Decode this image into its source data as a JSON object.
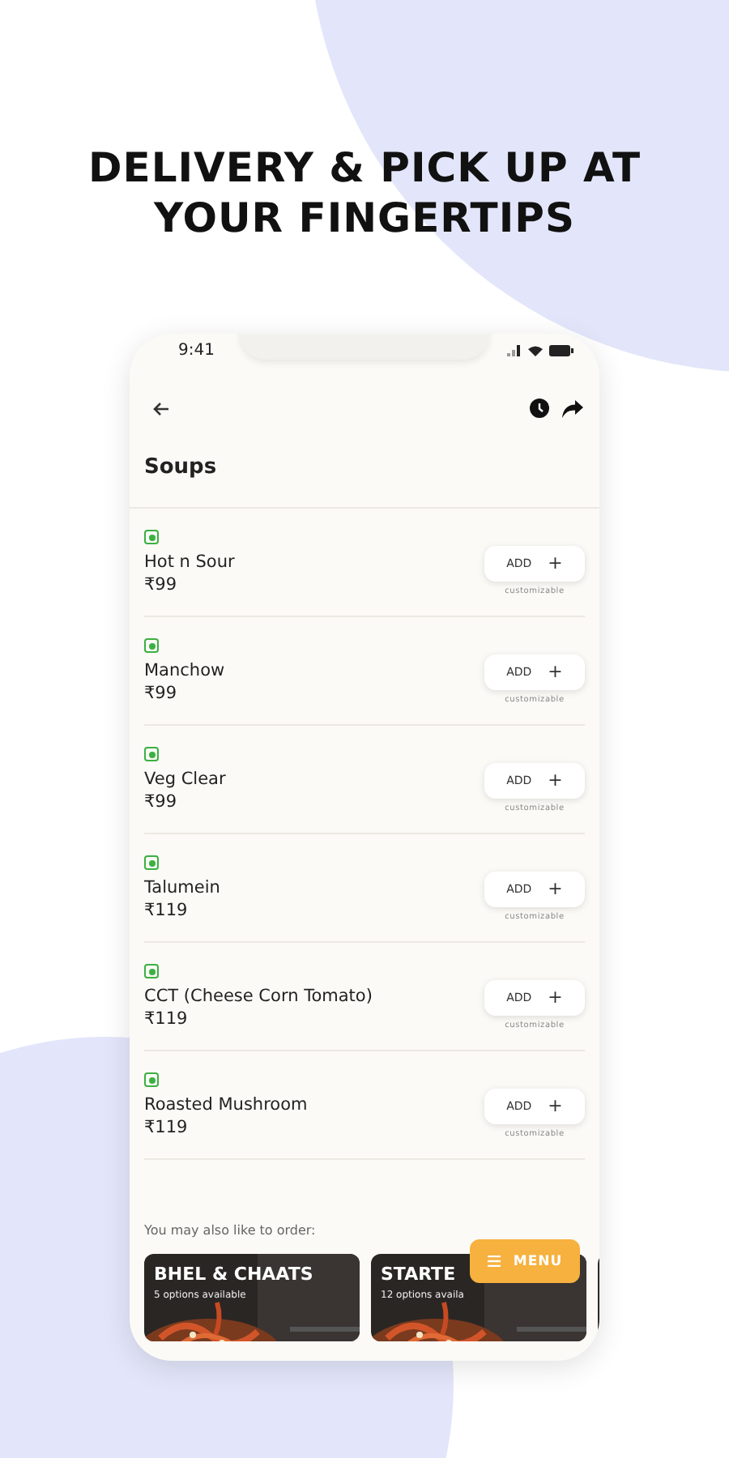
{
  "headline_lines": [
    "DELIVERY & PICK UP AT",
    "YOUR FINGERTIPS"
  ],
  "status_bar": {
    "time": "9:41"
  },
  "section_title": "Soups",
  "items": [
    {
      "name": "Hot n Sour",
      "price": "₹99",
      "veg": true,
      "button": "ADD",
      "button_icon": "+",
      "note": "customizable"
    },
    {
      "name": "Manchow",
      "price": "₹99",
      "veg": true,
      "button": "ADD",
      "button_icon": "+",
      "note": "customizable"
    },
    {
      "name": "Veg Clear",
      "price": "₹99",
      "veg": true,
      "button": "ADD",
      "button_icon": "+",
      "note": "customizable"
    },
    {
      "name": "Talumein",
      "price": "₹119",
      "veg": true,
      "button": "ADD",
      "button_icon": "+",
      "note": "customizable"
    },
    {
      "name": "CCT (Cheese Corn Tomato)",
      "price": "₹119",
      "veg": true,
      "button": "ADD",
      "button_icon": "+",
      "note": "customizable"
    },
    {
      "name": "Roasted Mushroom",
      "price": "₹119",
      "veg": true,
      "button": "ADD",
      "button_icon": "+",
      "note": "customizable"
    }
  ],
  "suggestion_heading": "You may also like to order:",
  "cards": [
    {
      "title": "BHEL & CHAATS",
      "subtitle": "5 options available"
    },
    {
      "title": "STARTE",
      "subtitle": "12 options availa"
    }
  ],
  "menu_button": {
    "label": "MENU"
  }
}
